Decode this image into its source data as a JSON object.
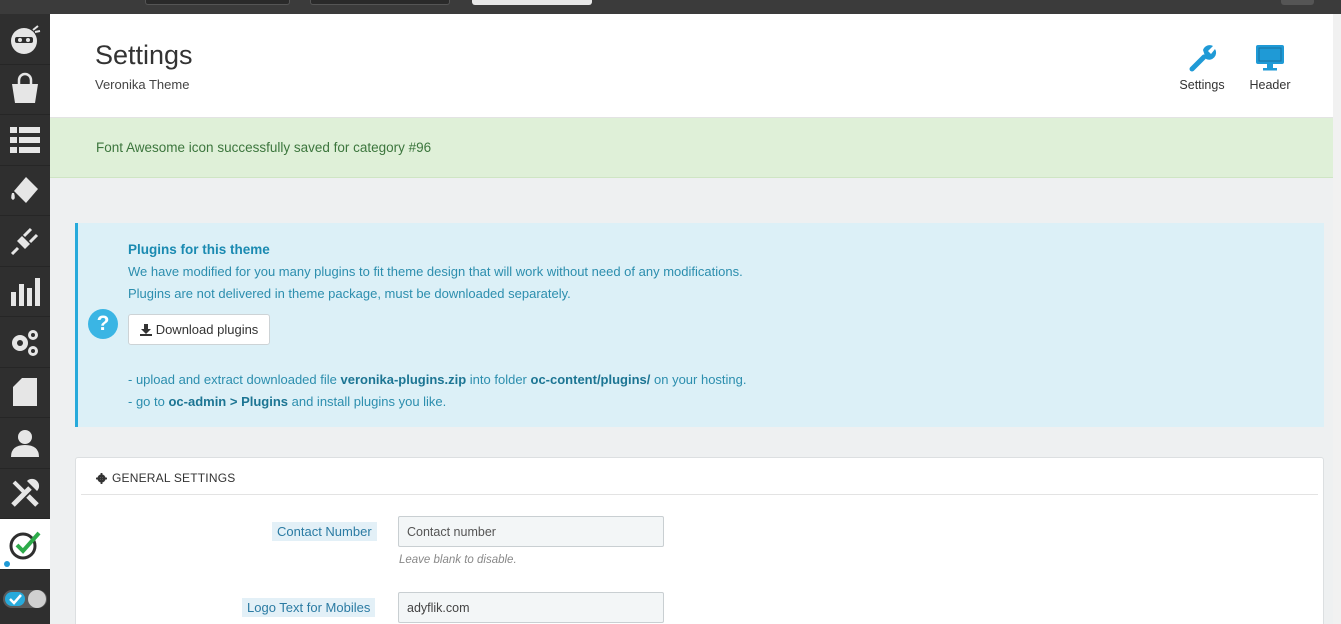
{
  "header": {
    "title": "Settings",
    "subtitle": "Veronika Theme",
    "buttons": [
      {
        "label": "Settings",
        "icon": "wrench-icon"
      },
      {
        "label": "Header",
        "icon": "monitor-icon"
      }
    ]
  },
  "flash": {
    "message": "Font Awesome icon successfully saved for category #96"
  },
  "info": {
    "title": "Plugins for this theme",
    "line1": "We have modified for you many plugins to fit theme design that will work without need of any modifications.",
    "line2": "Plugins are not delivered in theme package, must be downloaded separately.",
    "download_label": "Download plugins",
    "step1_pre": "- upload and extract downloaded file ",
    "step1_file": "veronika-plugins.zip",
    "step1_mid": " into folder ",
    "step1_folder": "oc-content/plugins/",
    "step1_post": " on your hosting.",
    "step2_pre": "- go to ",
    "step2_link": "oc-admin > Plugins",
    "step2_post": " and install plugins you like."
  },
  "panel": {
    "title": "GENERAL SETTINGS",
    "fields": [
      {
        "label": "Contact Number",
        "value": "",
        "placeholder": "Contact number",
        "hint": "Leave blank to disable."
      },
      {
        "label": "Logo Text for Mobiles",
        "value": "adyflik.com",
        "placeholder": ""
      }
    ]
  },
  "sidebar": {
    "items": [
      "dashboard-icon",
      "shopping-bag-icon",
      "list-icon",
      "paint-bucket-icon",
      "plug-icon",
      "bar-chart-icon",
      "gears-icon",
      "pages-icon",
      "user-icon",
      "tools-icon",
      "check-icon"
    ],
    "active": "check-icon"
  },
  "colors": {
    "accent": "#1f9ad6",
    "sidebar_bg": "#2f2f2f",
    "success_bg": "#dff0d8",
    "info_bg": "#dcf0f7"
  }
}
